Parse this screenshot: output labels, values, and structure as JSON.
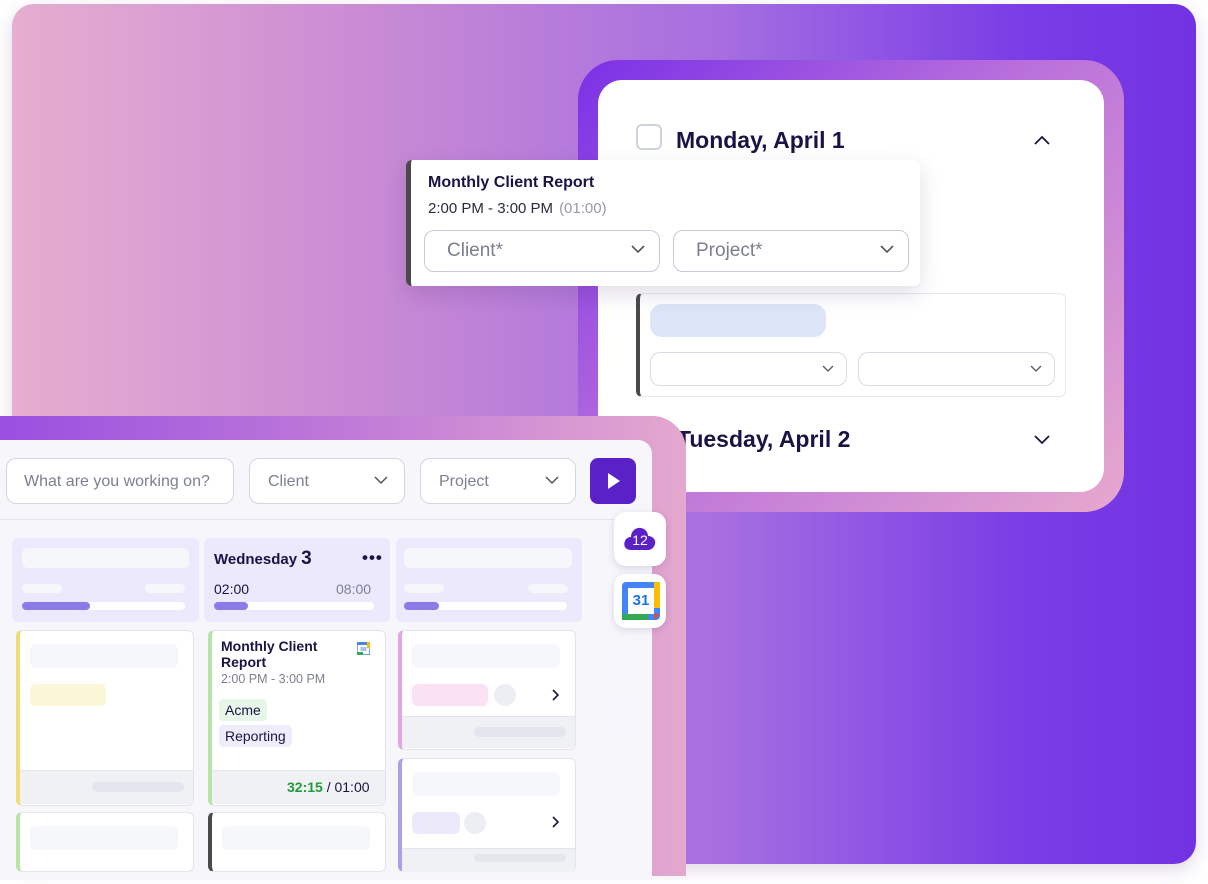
{
  "popup": {
    "title": "Monthly Client Report",
    "time": "2:00 PM - 3:00 PM",
    "duration": "(01:00)",
    "client_placeholder": "Client*",
    "project_placeholder": "Project*"
  },
  "calendar": {
    "day1": "Monday, April 1",
    "day2": "Tuesday, April 2"
  },
  "toolbar": {
    "description_placeholder": "What are you working on?",
    "client_label": "Client",
    "project_label": "Project"
  },
  "wednesday": {
    "day_name": "Wednesday",
    "day_number": "3",
    "menu": "•••",
    "tracked": "02:00",
    "planned": "08:00",
    "entry": {
      "title": "Monthly Client Report",
      "time": "2:00 PM - 3:00 PM",
      "client_tag": "Acme",
      "project_tag": "Reporting",
      "elapsed": "32:15",
      "separator": "/",
      "planned": "01:00"
    }
  },
  "side": {
    "cloud_badge": "12",
    "calendar_day": "31"
  },
  "icons": [
    "checkbox-icon",
    "chevron-up-icon",
    "chevron-down-icon",
    "play-icon",
    "google-calendar-icon",
    "cloud-icon",
    "chevron-right-icon"
  ],
  "colors": {
    "accent": "#5b21c8",
    "dark_text": "#1a1446",
    "elapsed_green": "#1f9a3b"
  }
}
